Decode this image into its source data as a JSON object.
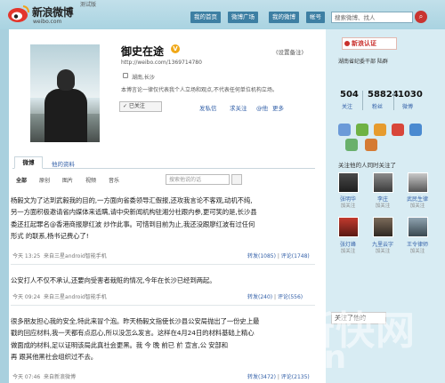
{
  "header": {
    "logo_cn": "新浪微博",
    "logo_en": "weibo.com",
    "beta": "测试版",
    "nav": [
      "我的首页",
      "微博广场",
      "我的微博",
      "帐号"
    ],
    "search_placeholder": "搜索微博、找人",
    "search_icon": "search-icon"
  },
  "profile": {
    "name": "御史在途",
    "verified": "V",
    "url": "http://weibo.com/1369714780",
    "settings": "(设置备注)",
    "location": "湖南,长沙",
    "bio": "本博言论一律仅代表我个人立场和观点,不代表任何单位机构立场。",
    "follow_btn": "✓ 已关注",
    "actions": [
      "发私信",
      "求关注",
      "@他",
      "更多"
    ]
  },
  "tabs": {
    "weibo": "微博",
    "profile": "他的资料"
  },
  "filters": {
    "items": [
      "全部",
      "原创",
      "图片",
      "视频",
      "音乐"
    ],
    "search_placeholder": "搜索他说的话"
  },
  "posts": [
    {
      "text": "杨毅文为了达到武毅我的目的,一方面向省委领导汇假报,还攻我言论不客观,动机不纯,\n另一方面积极邀请省内媒体来诋瞒,请中央新闻机构驻湘分社跟内参,更可笑的是,长沙县\n委还扛起罪名@香港商报廖红波 炒作此事。可惜到目前为止,我还没跟廖红波有过任何\n形式 的联系,杨书记费心了!",
      "time": "今天 13:25",
      "source": "来自三星android智能手机",
      "repost": "转发(1085)",
      "comment": "评论(1748)"
    },
    {
      "text": "公安打人不仅不承认,还要向受害者栽赃的情况,今年在长沙已经到两起。",
      "time": "今天 09:24",
      "source": "来自三星android智能手机",
      "repost": "转发(240)",
      "comment": "评论(556)"
    },
    {
      "text": "很多朋友担心我的安全,特此来冒个泡。昨天杨毅文指使长沙县公安局抛出了一份史上最\n戳的回应材料,我一天都有点忍心,所以没怎么发言。这样在4月24日的材料基础上精心\n做面成的材料,足以证明该局此真社会更黑。我 今 晚 前已 前 宣言,公 安部和    \n再 跟其他黑社会组织过不去。",
      "time": "今天 07:46",
      "source": "来自新浪微博",
      "repost": "转发(3472)",
      "comment": "评论(2135)"
    }
  ],
  "sidebar": {
    "auth_badge": "新浪认证",
    "auth_text": "湖南省纪委干部 陆群",
    "stats": [
      {
        "num": "504",
        "label": "关注"
      },
      {
        "num": "58824",
        "label": "粉丝"
      },
      {
        "num": "1030",
        "label": "微博"
      }
    ],
    "follow_title": "关注他的人同时关注了",
    "follows": [
      {
        "name": "张明华",
        "status": "加关注"
      },
      {
        "name": "李庄",
        "status": "加关注"
      },
      {
        "name": "武民生律",
        "status": "加关注"
      },
      {
        "name": "张灯峰",
        "status": "加关注"
      },
      {
        "name": "九里云字",
        "status": "加关注"
      },
      {
        "name": "王令律师",
        "status": "加关注"
      }
    ],
    "bottom_box": "关注了他的"
  },
  "watermark": {
    "line1": "新快网",
    "line2": "xxb.com.cn"
  }
}
